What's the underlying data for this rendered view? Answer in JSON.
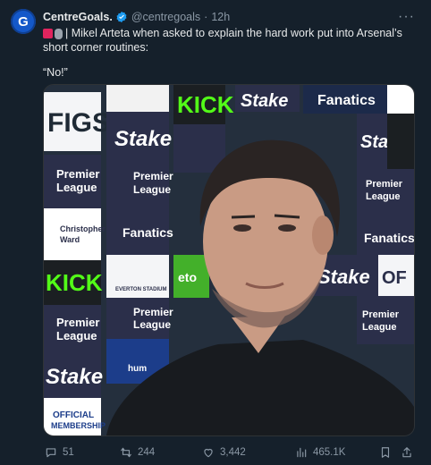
{
  "account": {
    "name": "CentreGoals.",
    "handle": "@centregoals",
    "separator": "·",
    "time": "12h",
    "avatar_letter": "G",
    "verified_color": "#1d9bf0"
  },
  "more_label": "···",
  "tweet": {
    "text": "| Mikel Arteta when asked to explain the hard work put into Arsenal’s short corner routines:",
    "quote": "“No!”",
    "emoji_icons": [
      "siren-icon",
      "microphone-icon"
    ]
  },
  "media": {
    "alt": "Mikel Arteta interview in front of sponsor backdrop",
    "backdrop_text": [
      "FIGS",
      "Stake",
      "KICK",
      "Fanatics",
      "Premier",
      "League",
      "Christopher",
      "Ward",
      "EVERTON STADIUM",
      "OFFICIAL",
      "MEMBERSHIP",
      "etoro",
      "hummel",
      "Stake",
      "Premier",
      "League"
    ]
  },
  "actions": {
    "replies": "51",
    "retweets": "244",
    "likes": "3,442",
    "views": "465.1K"
  },
  "colors": {
    "background": "#15202b",
    "text": "#e7e9ea",
    "muted": "#8b98a5",
    "accent": "#1d9bf0"
  }
}
